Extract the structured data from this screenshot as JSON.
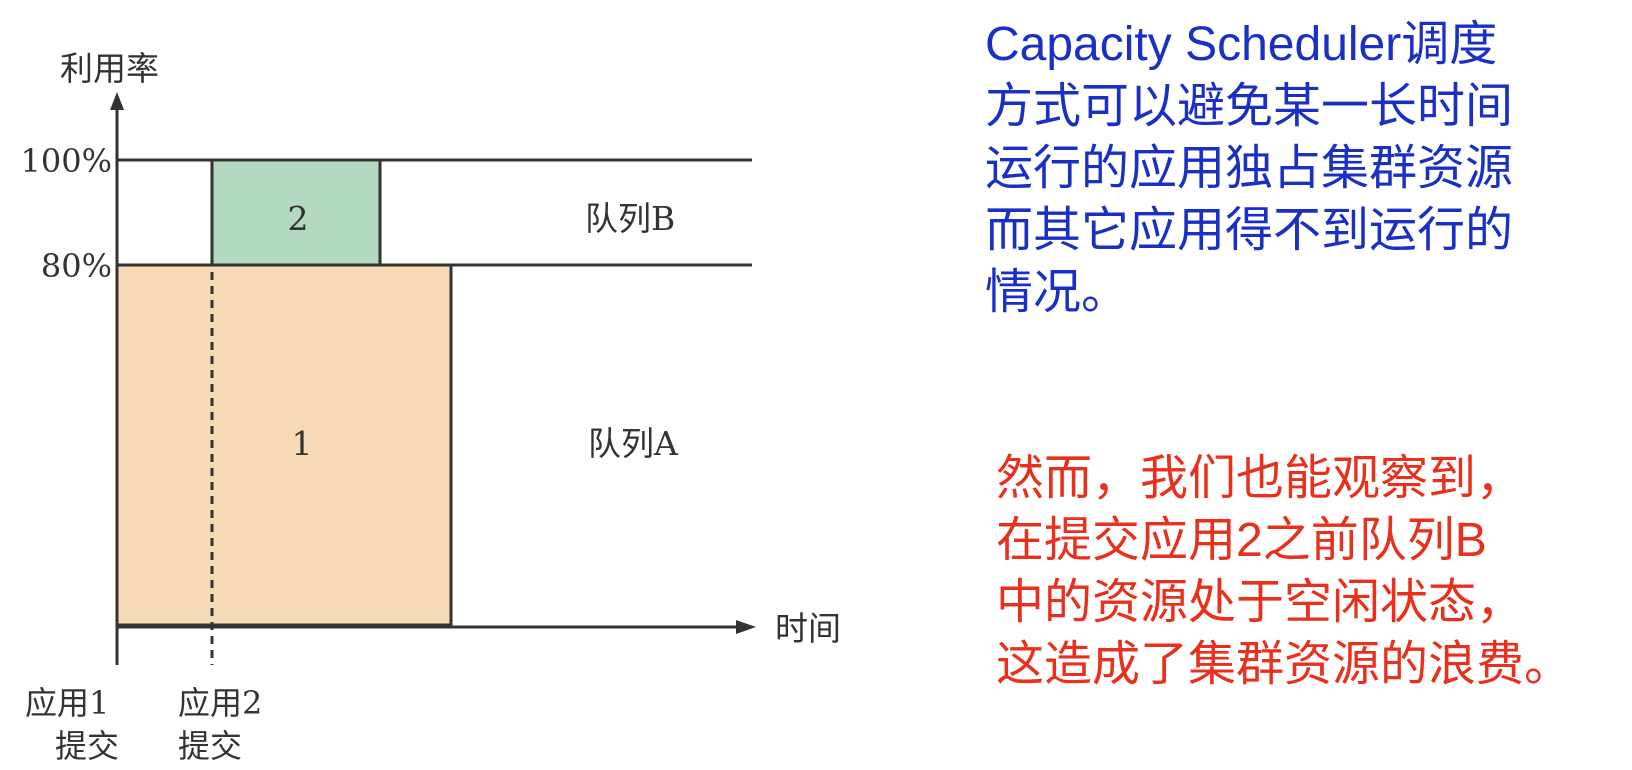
{
  "diagram": {
    "y_axis_label": "利用率",
    "x_axis_label": "时间",
    "tick_100": "100%",
    "tick_80": "80%",
    "queue_b_label": "队列B",
    "queue_a_label": "队列A",
    "block_app1_label": "1",
    "block_app2_label": "2",
    "app1_submit": [
      "应用1",
      "提交"
    ],
    "app2_submit": [
      "应用2",
      "提交"
    ],
    "colors": {
      "app1_fill": "#f6dab6",
      "app2_fill": "#b4d9c1",
      "line": "#333333"
    }
  },
  "notes": {
    "blue": {
      "color": "#1a2fc4",
      "lines": [
        "Capacity Scheduler调度",
        "方式可以避免某一长时间",
        "运行的应用独占集群资源",
        "而其它应用得不到运行的",
        "情况。"
      ]
    },
    "red": {
      "color": "#e8301c",
      "lines": [
        "然而，我们也能观察到，",
        "在提交应用2之前队列B",
        "中的资源处于空闲状态，",
        "这造成了集群资源的浪费。"
      ]
    }
  }
}
